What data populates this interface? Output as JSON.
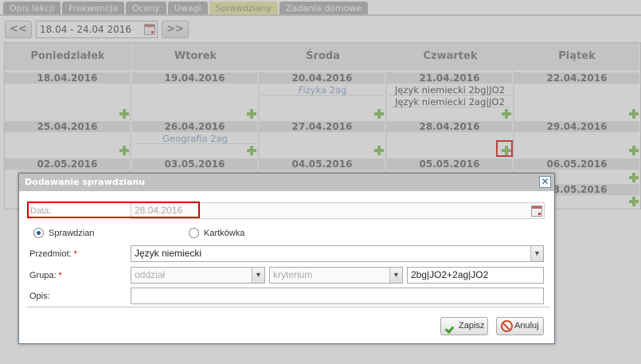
{
  "tabs": [
    "Opis lekcji",
    "Frekwencja",
    "Oceny",
    "Uwagi",
    "Sprawdziany",
    "Zadania domowe"
  ],
  "active_tab": "Sprawdziany",
  "week_nav": {
    "prev": "<<",
    "range": "18.04 - 24.04 2016",
    "next": ">>"
  },
  "days": [
    "Poniedziałek",
    "Wtorek",
    "Środa",
    "Czwartek",
    "Piątek"
  ],
  "weeks": [
    {
      "dates": [
        "18.04.2016",
        "19.04.2016",
        "20.04.2016",
        "21.04.2016",
        "22.04.2016"
      ]
    },
    {
      "dates": [
        "25.04.2016",
        "26.04.2016",
        "27.04.2016",
        "28.04.2016",
        "29.04.2016"
      ]
    },
    {
      "dates": [
        "02.05.2016",
        "03.05.2016",
        "04.05.2016",
        "05.05.2016",
        "06.05.2016"
      ]
    },
    {
      "dates": [
        "",
        "",
        "",
        "",
        "13.05.2016"
      ]
    }
  ],
  "entries": {
    "w1_sroda": "Fizyka 2ag",
    "w1_czwartek_1": "Język niemiecki 2bg|JO2",
    "w1_czwartek_2": "Język niemiecki 2ag|JO2",
    "w2_wtorek": "Geografia 2ag"
  },
  "dialog": {
    "title": "Dodawanie sprawdzianu",
    "close": "✕",
    "date_label": "Data:",
    "date_value": "28.04.2016",
    "radio_test": "Sprawdzian",
    "radio_quiz": "Kartkówka",
    "subject_label": "Przedmiot:",
    "subject_value": "Język niemiecki",
    "group_label": "Grupa:",
    "group_class_placeholder": "oddział",
    "group_criterion_placeholder": "kryterium",
    "group_value": "2bg|JO2+2ag|JO2",
    "desc_label": "Opis:",
    "desc_value": "",
    "required_mark": "*",
    "save_label": "Zapisz",
    "cancel_label": "Anuluj"
  },
  "colors": {
    "accent_tab": "#e9e39b",
    "highlight": "#d50000",
    "add_icon": "#7bba4a",
    "entry_blue": "#7c9ac2"
  }
}
